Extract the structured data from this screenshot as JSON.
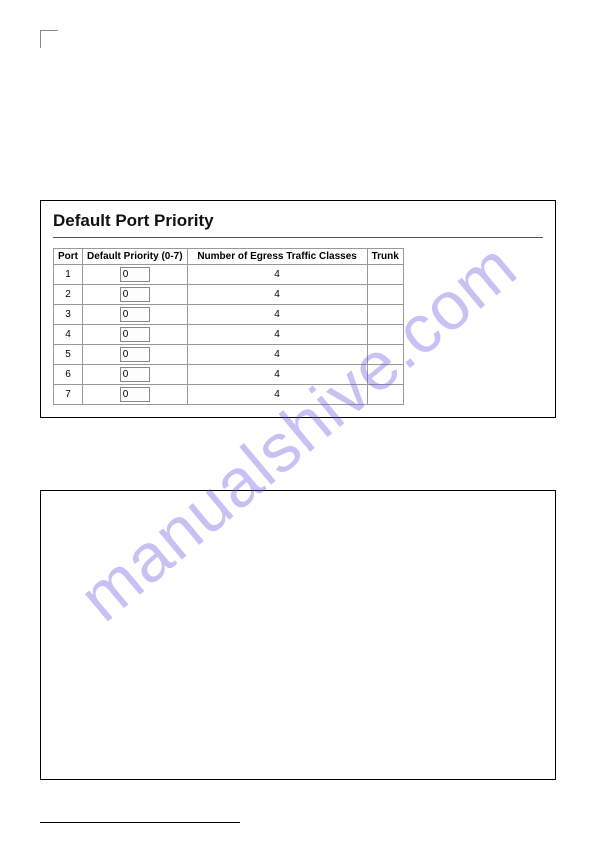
{
  "watermark": "manualshive.com",
  "figure": {
    "title": "Default Port Priority",
    "headers": {
      "port": "Port",
      "priority": "Default Priority (0-7)",
      "egress": "Number of Egress Traffic Classes",
      "trunk": "Trunk"
    },
    "rows": [
      {
        "port": "1",
        "priority": "0",
        "egress": "4",
        "trunk": ""
      },
      {
        "port": "2",
        "priority": "0",
        "egress": "4",
        "trunk": ""
      },
      {
        "port": "3",
        "priority": "0",
        "egress": "4",
        "trunk": ""
      },
      {
        "port": "4",
        "priority": "0",
        "egress": "4",
        "trunk": ""
      },
      {
        "port": "5",
        "priority": "0",
        "egress": "4",
        "trunk": ""
      },
      {
        "port": "6",
        "priority": "0",
        "egress": "4",
        "trunk": ""
      },
      {
        "port": "7",
        "priority": "0",
        "egress": "4",
        "trunk": ""
      }
    ]
  },
  "chart_data": {
    "type": "table",
    "title": "Default Port Priority",
    "columns": [
      "Port",
      "Default Priority (0-7)",
      "Number of Egress Traffic Classes",
      "Trunk"
    ],
    "rows": [
      [
        1,
        0,
        4,
        ""
      ],
      [
        2,
        0,
        4,
        ""
      ],
      [
        3,
        0,
        4,
        ""
      ],
      [
        4,
        0,
        4,
        ""
      ],
      [
        5,
        0,
        4,
        ""
      ],
      [
        6,
        0,
        4,
        ""
      ],
      [
        7,
        0,
        4,
        ""
      ]
    ]
  }
}
